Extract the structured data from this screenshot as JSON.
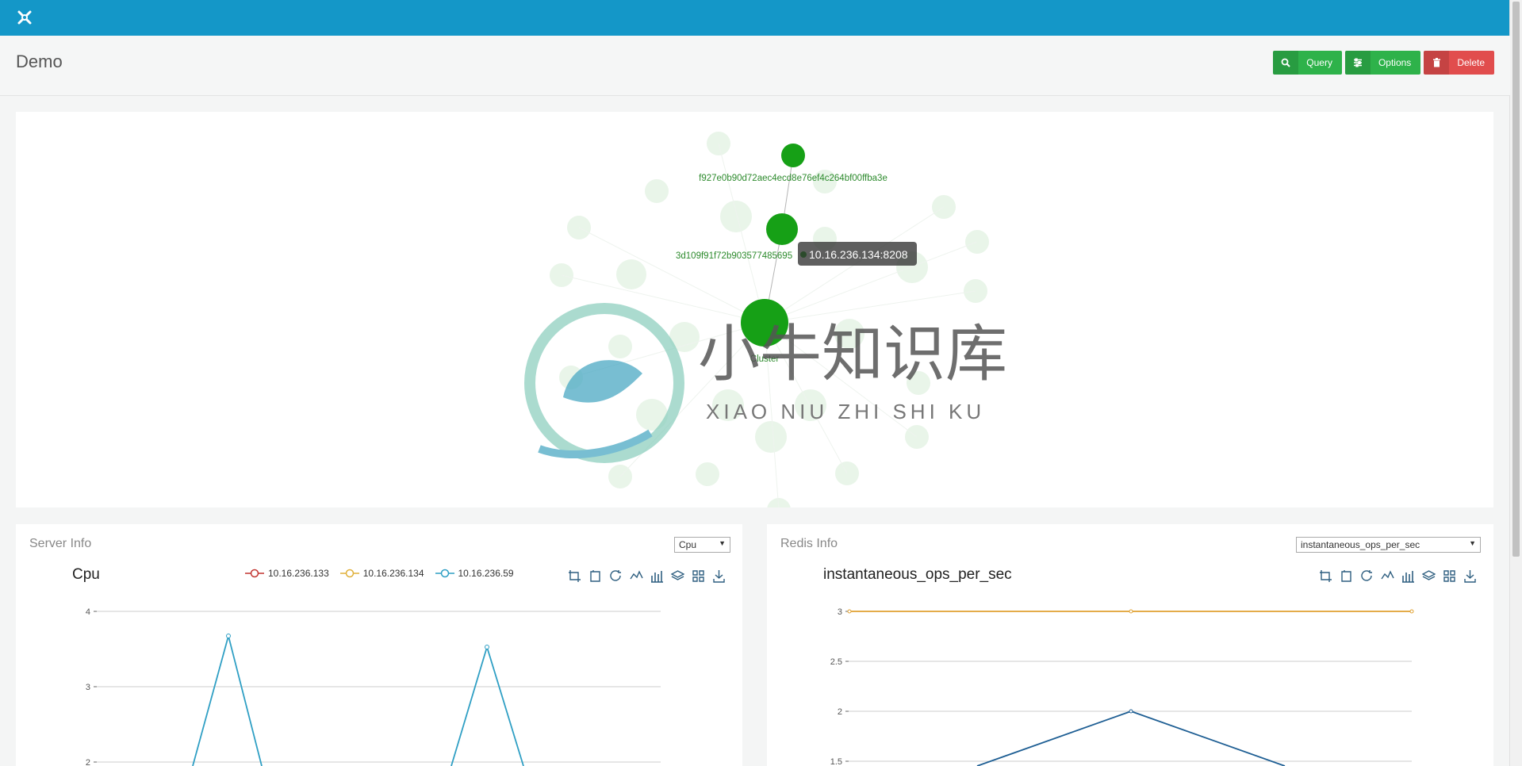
{
  "page": {
    "title": "Demo"
  },
  "toolbar": {
    "query_label": "Query",
    "options_label": "Options",
    "delete_label": "Delete"
  },
  "graph": {
    "node_labels": {
      "node1": "f927e0b90d72aec4ecd8e76ef4c264bf00ffba3e",
      "node2": "3d109f91f72b903577485695",
      "cluster": "Cluster"
    },
    "tooltip": "10.16.236.134:8208"
  },
  "watermark": {
    "cn": "小牛知识库",
    "en": "XIAO NIU ZHI SHI KU"
  },
  "server_info": {
    "title": "Server Info",
    "selected_metric": "Cpu",
    "chart_title": "Cpu",
    "legend": [
      "10.16.236.133",
      "10.16.236.134",
      "10.16.236.59"
    ],
    "y_ticks": [
      "4",
      "3",
      "2"
    ]
  },
  "redis_info": {
    "title": "Redis Info",
    "selected_metric": "instantaneous_ops_per_sec",
    "chart_title": "instantaneous_ops_per_sec",
    "y_ticks": [
      "3",
      "2.5",
      "2",
      "1.5"
    ]
  },
  "colors": {
    "topbar": "#1497c8",
    "green": "#2eb24a",
    "red": "#e14d4d",
    "node": "#16a016",
    "series_red": "#c23531",
    "series_yellow": "#e0b03a",
    "series_blue": "#2f9fc4",
    "series_navy": "#1f5f94"
  }
}
